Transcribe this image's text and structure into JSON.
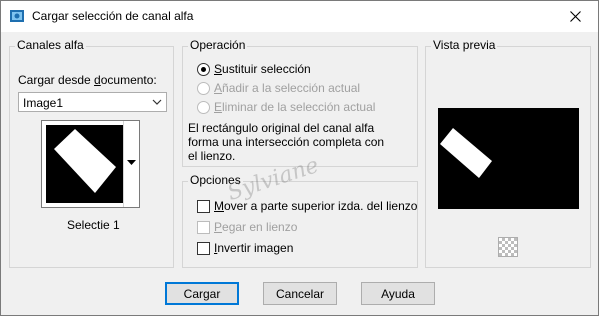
{
  "window": {
    "title": "Cargar selección de canal alfa"
  },
  "alpha_group": {
    "title": "Canales alfa",
    "load_from_label": "Cargar desde documento:",
    "document_selected": "Image1",
    "thumbnail_caption": "Selectie 1"
  },
  "operation_group": {
    "title": "Operación",
    "options": [
      {
        "label": "Sustituir selección",
        "selected": true,
        "enabled": true
      },
      {
        "label": "Añadir a la selección actual",
        "selected": false,
        "enabled": false
      },
      {
        "label": "Eliminar de la selección actual",
        "selected": false,
        "enabled": false
      }
    ],
    "description": "El rectángulo original del canal alfa forma una intersección completa con el lienzo."
  },
  "options_group": {
    "title": "Opciones",
    "checkboxes": [
      {
        "label": "Mover a parte superior izda. del lienzo",
        "checked": false,
        "enabled": true
      },
      {
        "label": "Pegar en lienzo",
        "checked": false,
        "enabled": false
      },
      {
        "label": "Invertir imagen",
        "checked": false,
        "enabled": true
      }
    ]
  },
  "preview_group": {
    "title": "Vista previa"
  },
  "buttons": {
    "load": "Cargar",
    "cancel": "Cancelar",
    "help": "Ayuda"
  },
  "watermark": "Sylviane",
  "colors": {
    "default_button_border": "#0078d7",
    "window_bg": "#f0f0f0",
    "titlebar_bg": "#ffffff"
  },
  "icons": {
    "title": "app-icon",
    "close": "close-icon",
    "combo": "chevron-down-icon",
    "zoom": "zoom-checker-icon"
  }
}
